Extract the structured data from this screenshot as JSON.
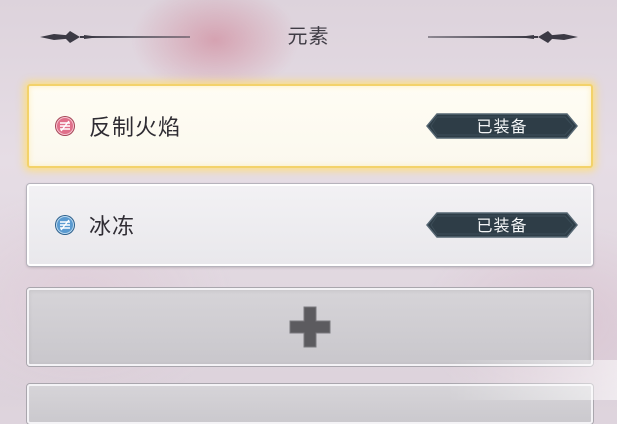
{
  "header": {
    "title": "元素"
  },
  "elements": [
    {
      "name": "反制火焰",
      "status": "已装备",
      "icon": "counter-fire-icon",
      "icon_color": "#d9607a",
      "selected": true
    },
    {
      "name": "冰冻",
      "status": "已装备",
      "icon": "freeze-icon",
      "icon_color": "#3f7fb8",
      "selected": false
    }
  ],
  "add_slot": {
    "icon": "plus-icon"
  },
  "colors": {
    "selected_glow": "#f3d26a",
    "badge_bg": "#2e3d47",
    "plus": "#5c5b5f"
  }
}
